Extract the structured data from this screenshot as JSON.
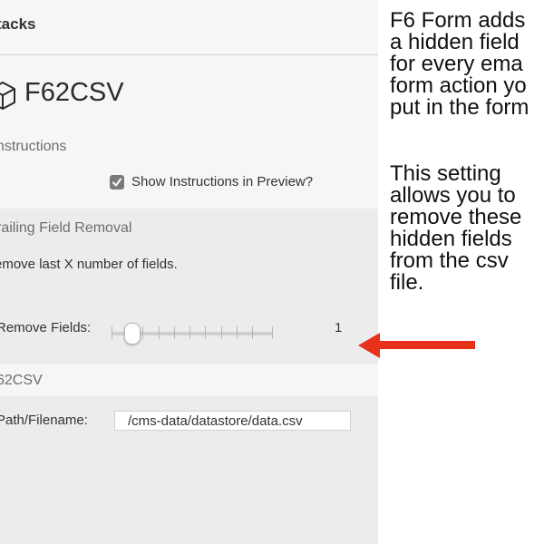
{
  "window": {
    "title": "tacks"
  },
  "plugin": {
    "name": "F62CSV",
    "icon": "cube-icon"
  },
  "sections": {
    "instructions": {
      "label": "nstructions",
      "checkbox_label": "Show Instructions in Preview?",
      "checkbox_checked": true
    },
    "trailing": {
      "label": "railing Field Removal",
      "description": "emove last X number of fields.",
      "remove_label": "Remove Fields:",
      "slider_value": "1"
    },
    "csv": {
      "label": "62CSV",
      "path_label": "Path/Filename:",
      "path_value": "/cms-data/datastore/data.csv"
    }
  },
  "callout": {
    "para1": [
      "F6 Form adds",
      "a hidden field",
      "for every ema",
      "form action yo",
      "put in the form"
    ],
    "para2": [
      "This setting",
      "allows you to",
      "remove these",
      "hidden fields",
      "from the csv",
      "file."
    ]
  },
  "colors": {
    "arrow": "#e8311a",
    "panel_bg": "#ececec",
    "band_bg": "#f6f6f6"
  }
}
